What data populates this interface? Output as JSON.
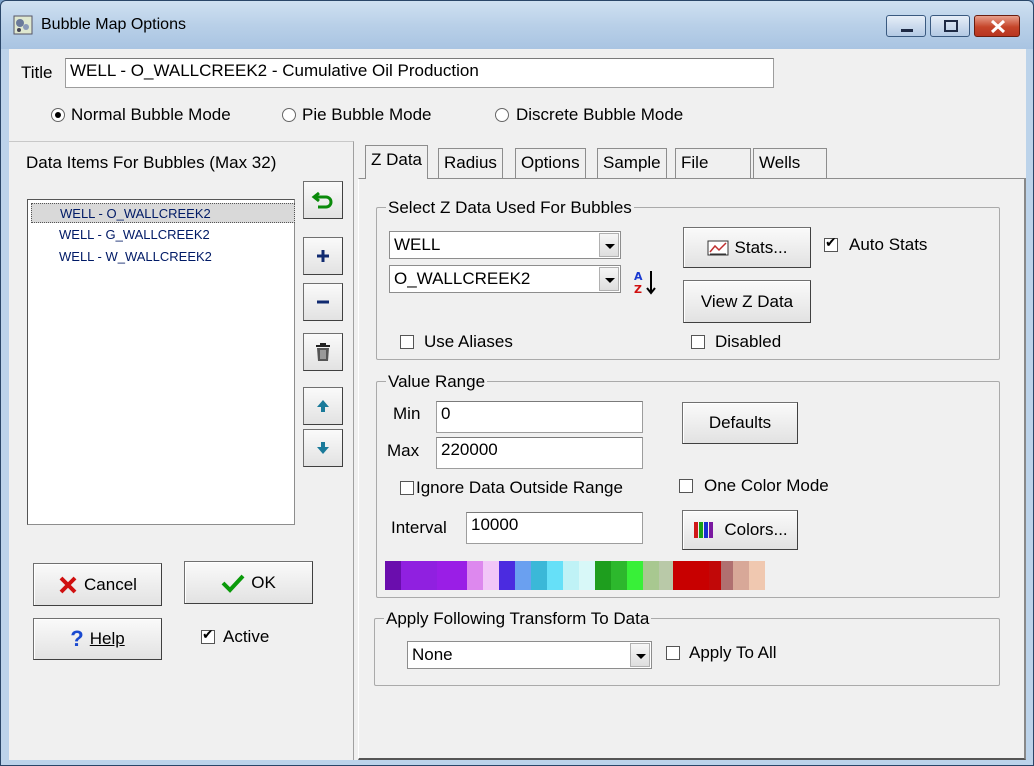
{
  "window": {
    "title": "Bubble Map Options"
  },
  "header": {
    "title_label": "Title",
    "title_value": "WELL - O_WALLCREEK2  - Cumulative Oil Production",
    "modes": [
      {
        "label": "Normal Bubble Mode",
        "selected": true
      },
      {
        "label": "Pie Bubble Mode",
        "selected": false
      },
      {
        "label": "Discrete Bubble Mode",
        "selected": false
      }
    ]
  },
  "left": {
    "heading": "Data Items For Bubbles (Max 32)",
    "items": [
      {
        "label": "WELL - O_WALLCREEK2",
        "selected": true
      },
      {
        "label": "WELL - G_WALLCREEK2",
        "selected": false
      },
      {
        "label": "WELL - W_WALLCREEK2",
        "selected": false
      }
    ],
    "cancel_label": "Cancel",
    "ok_label": "OK",
    "help_label": "Help",
    "active_label": "Active",
    "active_checked": true
  },
  "tabs": [
    {
      "label": "Z Data",
      "active": true
    },
    {
      "label": "Radius",
      "active": false
    },
    {
      "label": "Options",
      "active": false
    },
    {
      "label": "Sample",
      "active": false
    },
    {
      "label": "File",
      "active": false
    },
    {
      "label": "Wells",
      "active": false
    }
  ],
  "zdata": {
    "group_title": "Select Z Data Used For Bubbles",
    "source_combo": "WELL",
    "field_combo": "O_WALLCREEK2",
    "stats_label": "Stats...",
    "auto_stats_label": "Auto Stats",
    "auto_stats_checked": true,
    "view_label": "View Z Data",
    "use_aliases_label": "Use Aliases",
    "use_aliases_checked": false,
    "disabled_label": "Disabled",
    "disabled_checked": false
  },
  "range": {
    "group_title": "Value Range",
    "min_label": "Min",
    "min_value": "0",
    "max_label": "Max",
    "max_value": "220000",
    "defaults_label": "Defaults",
    "ignore_label": "Ignore Data Outside Range",
    "ignore_checked": false,
    "one_color_label": "One Color Mode",
    "one_color_checked": false,
    "interval_label": "Interval",
    "interval_value": "10000",
    "colors_label": "Colors...",
    "swatches": [
      "#6a0dad",
      "#9020e0",
      "#9a1ee6",
      "#dd88ee",
      "#f2c6f8",
      "#4b2be0",
      "#6aa0f0",
      "#3bb8d8",
      "#66e0f8",
      "#bff2f6",
      "#d8f8f8",
      "#1e9e1e",
      "#2db82d",
      "#38f038",
      "#a8c890",
      "#b9c9a8",
      "#c80000",
      "#c10808",
      "#b07070",
      "#d8a898",
      "#f0c8b0"
    ]
  },
  "transform": {
    "group_title": "Apply Following Transform To Data",
    "combo": "None",
    "apply_all_label": "Apply To All",
    "apply_all_checked": false
  }
}
